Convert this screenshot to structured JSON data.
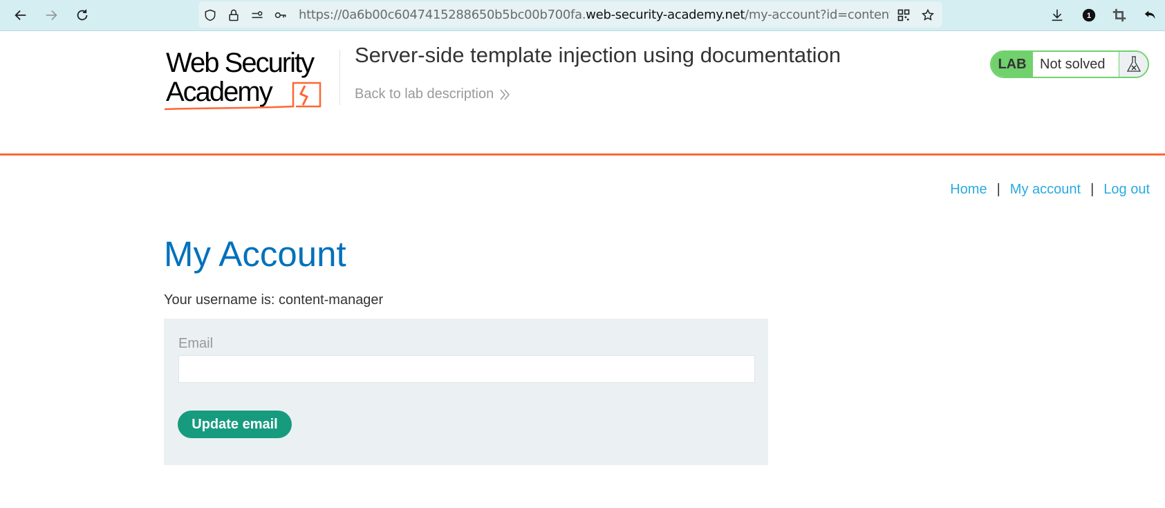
{
  "browser": {
    "url_prefix": "https://0a6b00c6047415288650b5bc00b700fa.",
    "url_host": "web-security-academy.net",
    "url_path": "/my-account?id=content-manager",
    "notification_count": "1",
    "icons": [
      "back-arrow-icon",
      "forward-arrow-icon",
      "reload-icon",
      "shield-icon",
      "lock-icon",
      "permissions-icon",
      "key-icon",
      "qr-code-icon",
      "star-icon",
      "download-icon",
      "extension-badge-icon",
      "crop-icon",
      "undo-icon"
    ]
  },
  "header": {
    "logo_line1": "Web Security",
    "logo_line2": "Academy",
    "lab_title": "Server-side template injection using documentation",
    "back_link": "Back to lab description",
    "lab_badge": "LAB",
    "lab_status": "Not solved"
  },
  "colors": {
    "accent_orange": "#ff6633",
    "title_blue": "#0071bc",
    "link_blue": "#29aae1",
    "lab_green": "#70d16d",
    "button_green": "#179b7f"
  },
  "nav": {
    "home": "Home",
    "separator": "|",
    "my_account": "My account",
    "log_out": "Log out"
  },
  "main": {
    "title": "My Account",
    "username_line": "Your username is: content-manager",
    "form": {
      "email_label": "Email",
      "email_value": "",
      "email_placeholder": "",
      "submit_label": "Update email"
    }
  }
}
